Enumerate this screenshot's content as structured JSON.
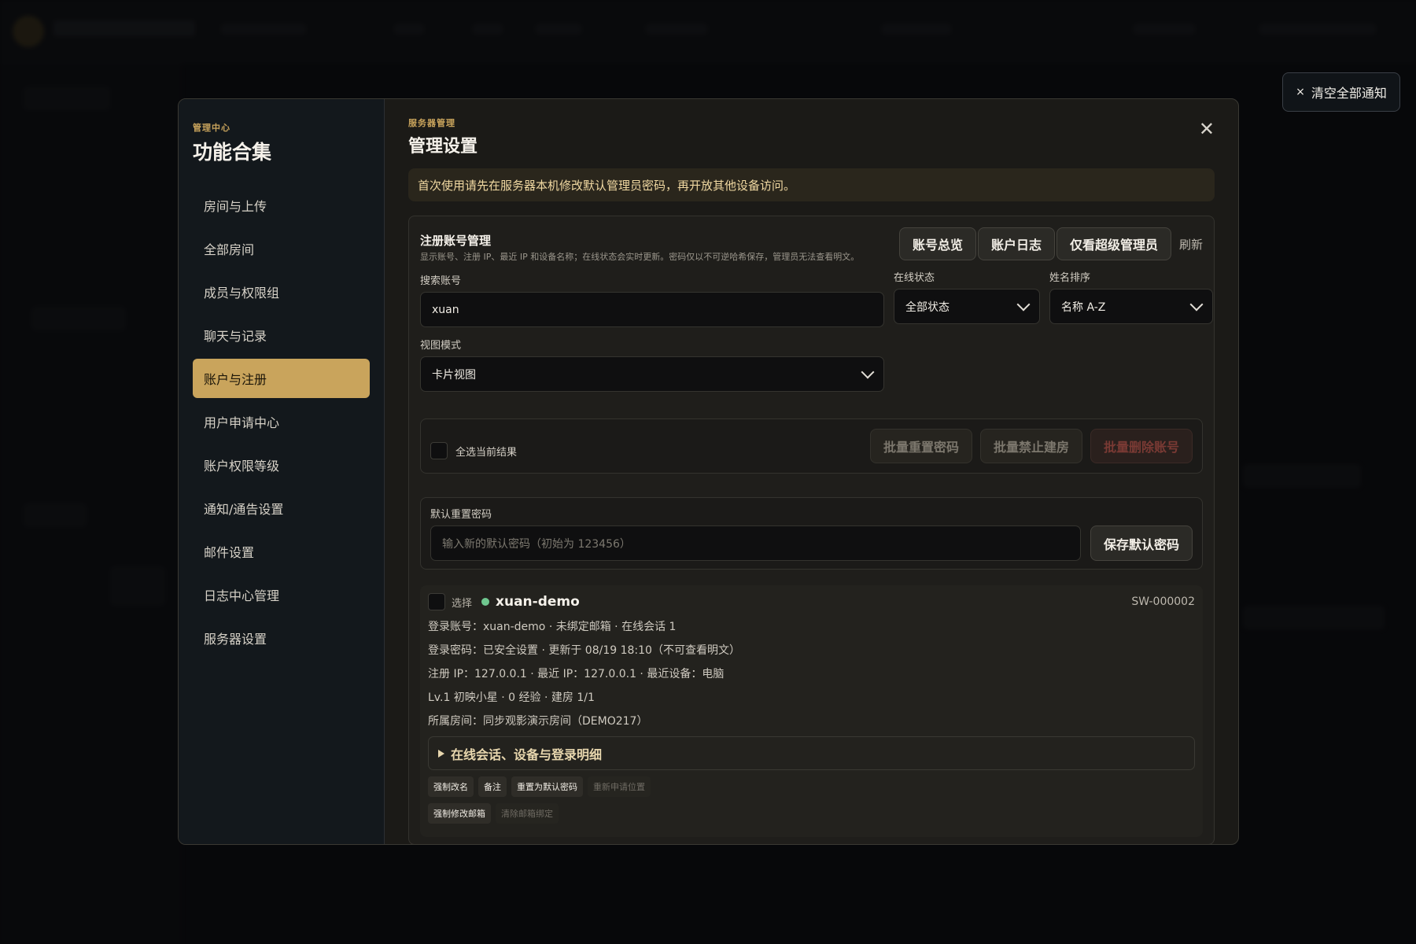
{
  "toast": {
    "icon": "×",
    "label": "清空全部通知"
  },
  "sidebar": {
    "eyebrow": "管理中心",
    "title": "功能合集",
    "items": [
      {
        "label": "房间与上传",
        "active": false
      },
      {
        "label": "全部房间",
        "active": false
      },
      {
        "label": "成员与权限组",
        "active": false
      },
      {
        "label": "聊天与记录",
        "active": false
      },
      {
        "label": "账户与注册",
        "active": true
      },
      {
        "label": "用户申请中心",
        "active": false
      },
      {
        "label": "账户权限等级",
        "active": false
      },
      {
        "label": "通知/通告设置",
        "active": false
      },
      {
        "label": "邮件设置",
        "active": false
      },
      {
        "label": "日志中心管理",
        "active": false
      },
      {
        "label": "服务器设置",
        "active": false
      }
    ]
  },
  "main": {
    "eyebrow": "服务器管理",
    "title": "管理设置",
    "close_icon": "close-icon",
    "notice": "首次使用请先在服务器本机修改默认管理员密码，再开放其他设备访问。"
  },
  "panel": {
    "title": "注册账号管理",
    "subtitle": "显示账号、注册 IP、最近 IP 和设备名称；在线状态会实时更新。密码仅以不可逆哈希保存，管理员无法查看明文。",
    "buttons": [
      "账号总览",
      "账户日志",
      "仅看超级管理员"
    ],
    "refresh": "刷新",
    "search": {
      "label": "搜索账号",
      "value": "xuan"
    },
    "status": {
      "label": "在线状态",
      "value": "全部状态"
    },
    "sort": {
      "label": "姓名排序",
      "value": "名称 A-Z"
    },
    "view": {
      "label": "视图模式",
      "value": "卡片视图"
    }
  },
  "batch": {
    "select_all": "全选当前结果",
    "reset": "批量重置密码",
    "ban": "批量禁止建房",
    "delete": "批量删除账号"
  },
  "default_password": {
    "label": "默认重置密码",
    "placeholder": "输入新的默认密码（初始为 123456）",
    "save": "保存默认密码"
  },
  "card": {
    "select": "选择",
    "name": "xuan-demo",
    "id": "SW-000002",
    "status_color": "#6fc78f",
    "lines": [
      "登录账号：xuan-demo · 未绑定邮箱 · 在线会话 1",
      "登录密码：已安全设置 · 更新于 08/19 18:10（不可查看明文）",
      "注册 IP：127.0.0.1 · 最近 IP：127.0.0.1 · 最近设备：电脑",
      "Lv.1 初映小星 · 0 经验 · 建房 1/1",
      "所属房间：同步观影演示房间（DEMO217）"
    ],
    "detail": "在线会话、设备与登录明细",
    "chips": [
      "强制改名",
      "备注",
      "重置为默认密码",
      "重新申请位置"
    ],
    "chips2": [
      "强制修改邮箱",
      "清除邮箱绑定"
    ]
  }
}
